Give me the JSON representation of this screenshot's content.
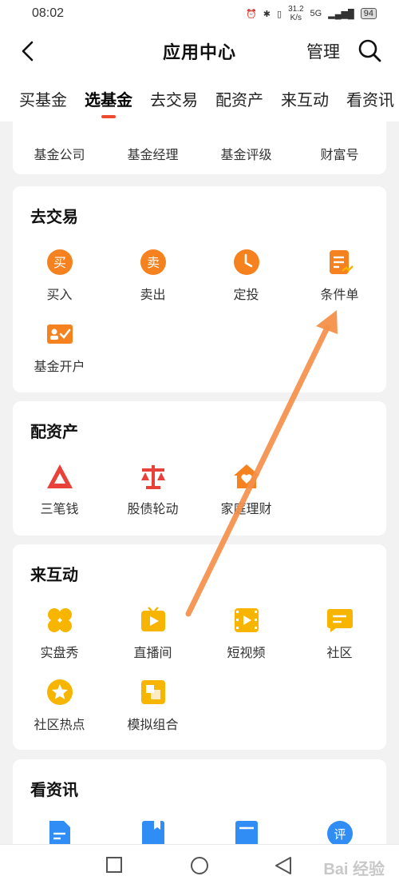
{
  "status": {
    "time": "08:02",
    "speed_top": "31.2",
    "speed_bottom": "K/s",
    "network": "5G",
    "battery": "94"
  },
  "header": {
    "title": "应用中心",
    "manage_label": "管理"
  },
  "tabs": [
    {
      "label": "买基金"
    },
    {
      "label": "选基金"
    },
    {
      "label": "去交易"
    },
    {
      "label": "配资产"
    },
    {
      "label": "来互动"
    },
    {
      "label": "看资讯"
    }
  ],
  "select_fund": {
    "items": [
      "基金公司",
      "基金经理",
      "基金评级",
      "财富号"
    ]
  },
  "trade": {
    "title": "去交易",
    "items": [
      {
        "label": "买入",
        "glyph": "买"
      },
      {
        "label": "卖出",
        "glyph": "卖"
      },
      {
        "label": "定投"
      },
      {
        "label": "条件单"
      },
      {
        "label": "基金开户"
      }
    ]
  },
  "assets": {
    "title": "配资产",
    "items": [
      "三笔钱",
      "股债轮动",
      "家庭理财"
    ]
  },
  "interact": {
    "title": "来互动",
    "items": [
      "实盘秀",
      "直播间",
      "短视频",
      "社区",
      "社区热点",
      "模拟组合"
    ]
  },
  "news": {
    "title": "看资讯",
    "items": [
      {
        "glyph": ""
      },
      {
        "glyph": ""
      },
      {
        "glyph": ""
      },
      {
        "glyph": "评"
      }
    ]
  },
  "watermark": "Bai 经验",
  "colors": {
    "accent": "#ef4a2d",
    "orange": "#f5821f",
    "yellow": "#f7b500",
    "blue": "#2f8df5",
    "arrow": "#f6904a"
  }
}
